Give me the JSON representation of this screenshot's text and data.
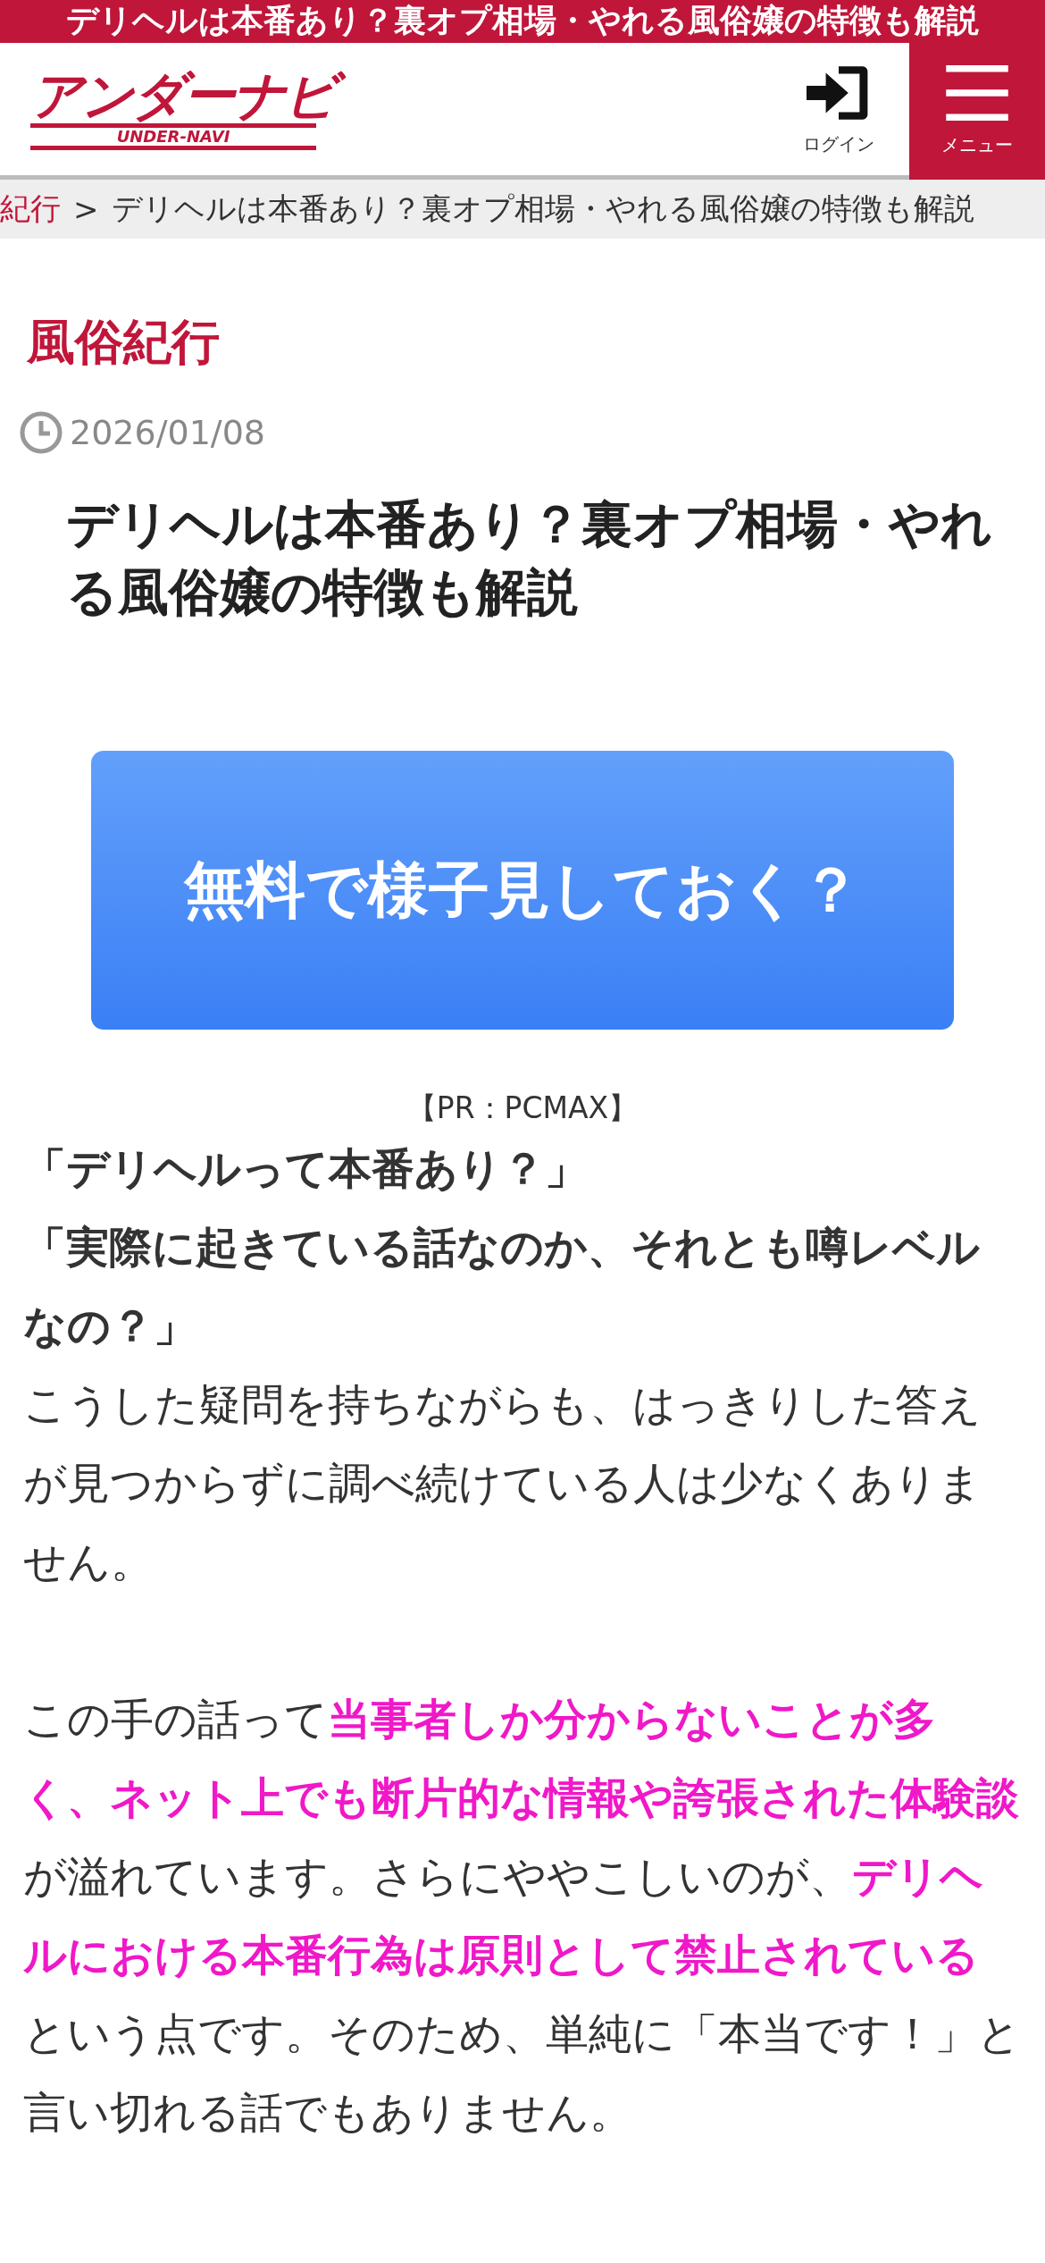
{
  "top_banner": {
    "title": "デリヘルは本番あり？裏オプ相場・やれる風俗嬢の特徴も解説"
  },
  "header": {
    "logo": {
      "main": "アンダーナビ",
      "sub": "UNDER-NAVI"
    },
    "login": {
      "label": "ログイン"
    },
    "menu": {
      "label": "メニュー"
    }
  },
  "breadcrumb": {
    "items": [
      {
        "label": "紀行"
      },
      {
        "label": "デリヘルは本番あり？裏オプ相場・やれる風俗嬢の特徴も解説"
      }
    ],
    "separator": ">"
  },
  "article": {
    "category": "風俗紀行",
    "date": "2026/01/08",
    "title": "デリヘルは本番あり？裏オプ相場・やれる風俗嬢の特徴も解説",
    "cta": {
      "label": "無料で様子見しておく？",
      "note": "【PR：PCMAX】"
    },
    "blocks": [
      {
        "kind": "quote",
        "text": "「デリヘルって本番あり？」"
      },
      {
        "kind": "quote",
        "text": "「実際に起きている話なのか、それとも噂レベルなの？」"
      },
      {
        "kind": "paragraph",
        "text": "こうした疑問を持ちながらも、はっきりした答えが見つからずに調べ続けている人は少なくありません。"
      },
      {
        "kind": "paragraph",
        "text": "この手の話って**当事者しか分からないことが多く、ネット上でも断片的な情報や誇張された体験談**が溢れています。さらにややこしいのが、**デリヘルにおける本番行為は原則として禁止されている**という点です。そのため、単純に「本当です！」と言い切れる話でもありません。"
      }
    ]
  }
}
